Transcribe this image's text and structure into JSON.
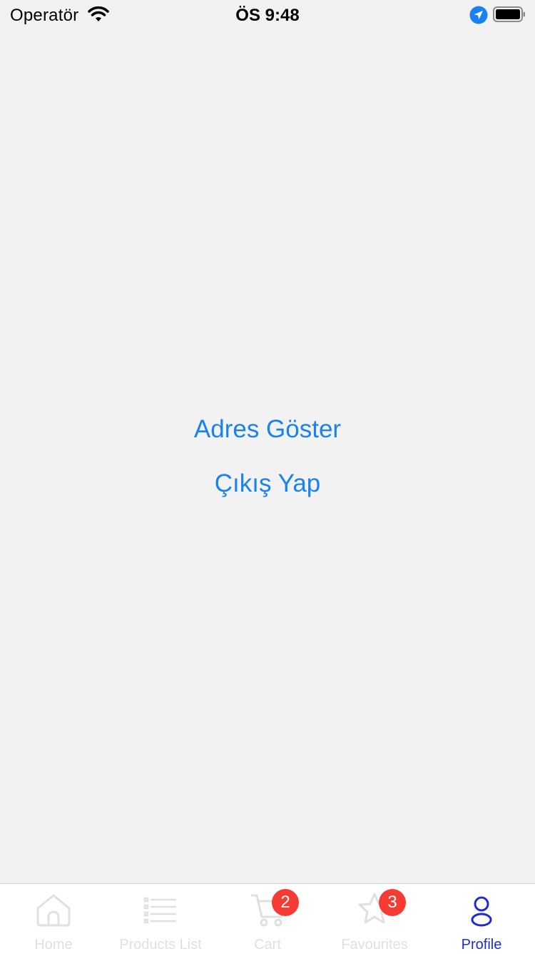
{
  "status_bar": {
    "carrier": "Operatör",
    "time": "ÖS 9:48",
    "icons": [
      "wifi-icon",
      "location-arrow-icon",
      "battery-icon"
    ]
  },
  "main": {
    "show_address_label": "Adres Göster",
    "logout_label": "Çıkış Yap"
  },
  "tab_bar": {
    "tabs": [
      {
        "label": "Home",
        "icon": "home-icon",
        "active": false
      },
      {
        "label": "Products List",
        "icon": "list-icon",
        "active": false
      },
      {
        "label": "Cart",
        "icon": "cart-icon",
        "active": false,
        "badge": "2"
      },
      {
        "label": "Favourites",
        "icon": "star-icon",
        "active": false,
        "badge": "3"
      },
      {
        "label": "Profile",
        "icon": "person-icon",
        "active": true
      }
    ]
  },
  "colors": {
    "background": "#f2f2f2",
    "link": "#1a82f0",
    "tab_active": "#1f2bd6",
    "tab_inactive": "#e0e0e0",
    "badge": "#f53b32"
  }
}
